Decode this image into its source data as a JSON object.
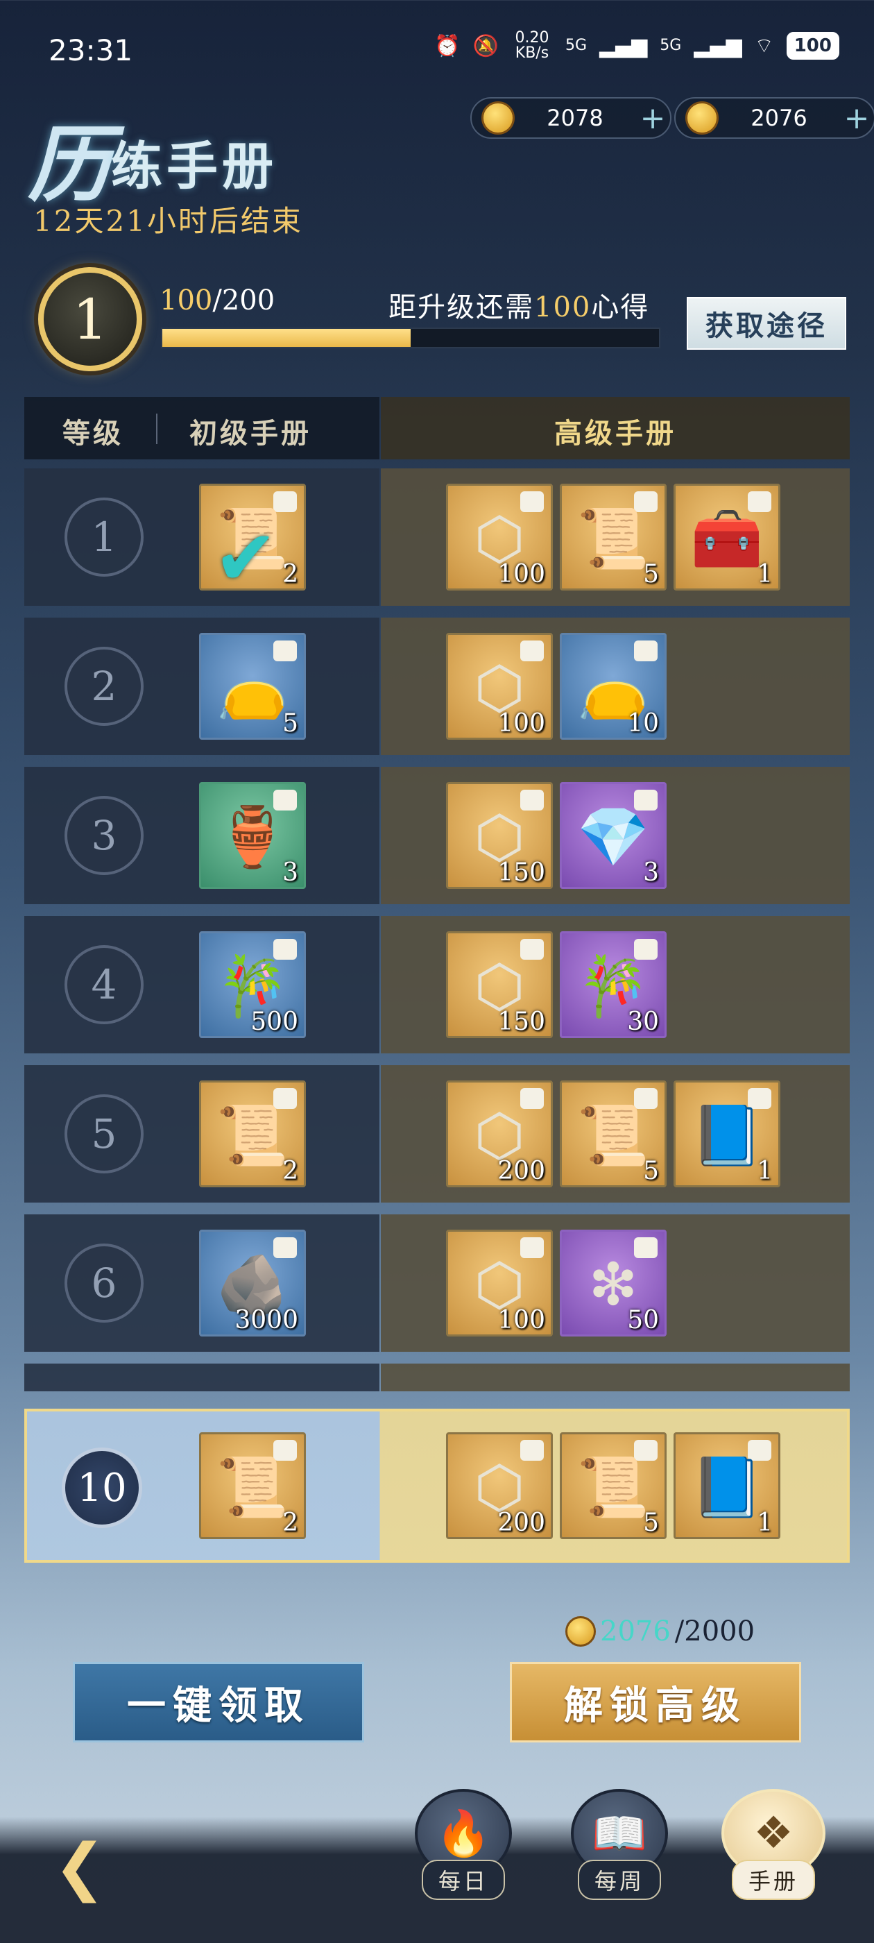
{
  "status_bar": {
    "time": "23:31",
    "net_speed": "0.20 KB/s",
    "signal_1": "5G",
    "signal_2": "5G",
    "battery": "100"
  },
  "header": {
    "title_big": "历",
    "title_rest": "练手册",
    "countdown": "12天21小时后结束"
  },
  "currencies": [
    {
      "value": "2078",
      "icon": "gold-ingot-icon"
    },
    {
      "value": "2076",
      "icon": "gold-coin-pouch-icon"
    }
  ],
  "level": {
    "current": "1",
    "progress_current": "100",
    "progress_total": "/200",
    "progress_fraction": 0.5,
    "need_prefix": "距升级还需",
    "need_value": "100",
    "need_suffix": "心得",
    "obtain_button": "获取途径"
  },
  "table": {
    "headers": {
      "level": "等级",
      "basic": "初级手册",
      "advanced": "高级手册"
    },
    "rows": [
      {
        "level": "1",
        "basic": {
          "qty": "2",
          "style": "gold",
          "icon": "scroll-icon",
          "claimed": true
        },
        "advanced": [
          {
            "qty": "100",
            "style": "gold",
            "icon": "purple-rune-icon"
          },
          {
            "qty": "5",
            "style": "gold",
            "icon": "scroll-icon"
          },
          {
            "qty": "1",
            "style": "gold",
            "icon": "treasure-chest-icon"
          }
        ]
      },
      {
        "level": "2",
        "basic": {
          "qty": "5",
          "style": "blue",
          "icon": "green-pouch-icon"
        },
        "advanced": [
          {
            "qty": "100",
            "style": "gold",
            "icon": "purple-rune-icon"
          },
          {
            "qty": "10",
            "style": "blue",
            "icon": "green-pouch-icon"
          }
        ]
      },
      {
        "level": "3",
        "basic": {
          "qty": "3",
          "style": "green",
          "icon": "water-pitcher-icon"
        },
        "advanced": [
          {
            "qty": "150",
            "style": "gold",
            "icon": "purple-rune-icon"
          },
          {
            "qty": "3",
            "style": "purple",
            "icon": "purple-crystal-icon"
          }
        ]
      },
      {
        "level": "4",
        "basic": {
          "qty": "500",
          "style": "blue",
          "icon": "bamboo-scroll-icon"
        },
        "advanced": [
          {
            "qty": "150",
            "style": "gold",
            "icon": "purple-rune-icon"
          },
          {
            "qty": "30",
            "style": "purple",
            "icon": "bamboo-scroll-icon"
          }
        ]
      },
      {
        "level": "5",
        "basic": {
          "qty": "2",
          "style": "gold",
          "icon": "scroll-icon"
        },
        "advanced": [
          {
            "qty": "200",
            "style": "gold",
            "icon": "purple-rune-icon"
          },
          {
            "qty": "5",
            "style": "gold",
            "icon": "scroll-icon"
          },
          {
            "qty": "1",
            "style": "gold",
            "icon": "spell-book-icon"
          }
        ]
      },
      {
        "level": "6",
        "basic": {
          "qty": "3000",
          "style": "blue",
          "icon": "dark-ore-icon"
        },
        "advanced": [
          {
            "qty": "100",
            "style": "gold",
            "icon": "purple-rune-icon"
          },
          {
            "qty": "50",
            "style": "purple",
            "icon": "jade-shards-icon"
          }
        ]
      }
    ],
    "pinned_row": {
      "level": "10",
      "basic": {
        "qty": "2",
        "style": "gold",
        "icon": "scroll-icon"
      },
      "advanced": [
        {
          "qty": "200",
          "style": "gold",
          "icon": "purple-rune-icon"
        },
        {
          "qty": "5",
          "style": "gold",
          "icon": "scroll-icon"
        },
        {
          "qty": "1",
          "style": "gold",
          "icon": "spell-book-icon"
        }
      ]
    }
  },
  "cost": {
    "have": "2076",
    "need": "/2000"
  },
  "buttons": {
    "claim_all": "一键领取",
    "unlock_advanced": "解锁高级"
  },
  "nav": {
    "daily": "每日",
    "weekly": "每周",
    "manual": "手册"
  }
}
